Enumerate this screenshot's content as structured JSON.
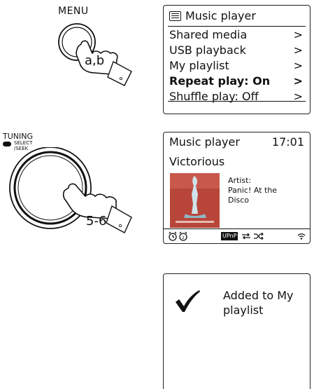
{
  "menu_button": {
    "label": "MENU",
    "step": "a,b"
  },
  "tuning_knob": {
    "label": "TUNING",
    "select": "SELECT",
    "seek": "/SEEK",
    "step": "5-6"
  },
  "menu_screen": {
    "title": "Music player",
    "items": [
      {
        "label": "Shared media",
        "arrow": ">",
        "bold": false
      },
      {
        "label": "USB playback",
        "arrow": ">",
        "bold": false
      },
      {
        "label": "My playlist",
        "arrow": ">",
        "bold": false
      },
      {
        "label": "Repeat play: On",
        "arrow": ">",
        "bold": true
      },
      {
        "label": "Shuffle play: Off",
        "arrow": ">",
        "bold": false
      }
    ]
  },
  "now_playing": {
    "header": "Music player",
    "time": "17:01",
    "track": "Victorious",
    "artist_label": "Artist:",
    "artist_line1": "Panic! At the",
    "artist_line2": "Disco",
    "source_badge": "UPnP",
    "album_art_color": "#b8453a"
  },
  "confirmation": {
    "line1": "Added to My",
    "line2": "playlist"
  }
}
